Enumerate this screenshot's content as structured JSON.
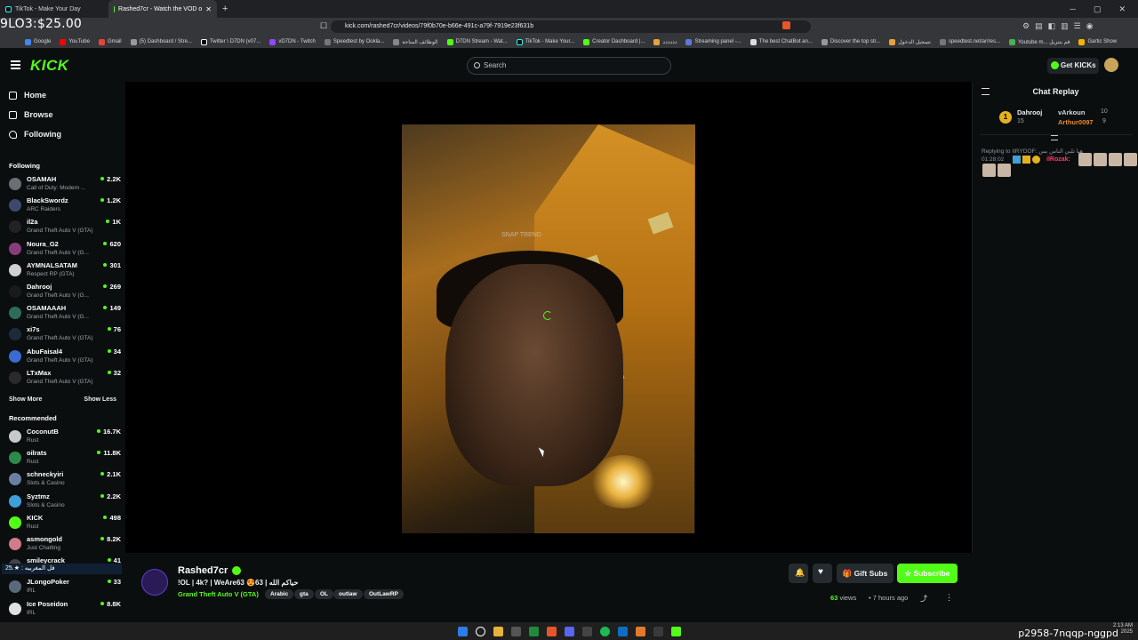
{
  "browser": {
    "tabs": [
      {
        "label": "TikTok - Make Your Day"
      },
      {
        "label": "Rashed7cr - Watch the VOD o"
      }
    ],
    "url": "kick.com/rashed7cr/videos/79f0b70e-b66e-491c-a79f-7919e23f631b",
    "bookmarks": [
      "Google",
      "YouTube",
      "Gmail",
      "(5) Dashboard / Stre...",
      "Twitter \\ D7DN (v07...",
      "vD7DN - Twitch",
      "Speedtest by Ookla...",
      "الوظائف المتاحة",
      "D7DN Stream - Wat...",
      "TikTok - Make Your...",
      "Creator Dashboard |...",
      "دددددد",
      "Streaming panel -...",
      "The best ChatBot an...",
      "Discover the top str...",
      "تسجيل الدخول",
      "speedtest.net/ar/res...",
      "Youtube m... قم بتنزيل",
      "Gartic Show"
    ]
  },
  "overlay": {
    "balance": "9LO3:$25.00",
    "obs_text": "فل المغربيه : ★.25",
    "code": "p2958-7nqqp-nggpd",
    "clock_time": "2:13 AM",
    "clock_date": "2025"
  },
  "header": {
    "logo": "KICK",
    "search_placeholder": "Search",
    "get_kicks": "Get KICKs"
  },
  "sidebar": {
    "nav": [
      {
        "label": "Home"
      },
      {
        "label": "Browse"
      },
      {
        "label": "Following"
      }
    ],
    "following_title": "Following",
    "following": [
      {
        "name": "OSAMAH",
        "category": "Call of Duty: Modern ...",
        "viewers": "2.2K",
        "color": "#6b6f73"
      },
      {
        "name": "BlackSwordz",
        "category": "ARC Raiders",
        "viewers": "1.2K",
        "color": "#3b4a6b"
      },
      {
        "name": "il2a",
        "category": "Grand Theft Auto V (GTA)",
        "viewers": "1K",
        "color": "#222"
      },
      {
        "name": "Noura_G2",
        "category": "Grand Theft Auto V (G...",
        "viewers": "620",
        "color": "#8a3c7a"
      },
      {
        "name": "AYMNALSATAM",
        "category": "Respect RP (GTA)",
        "viewers": "301",
        "color": "#d0d0d0"
      },
      {
        "name": "Dahrooj",
        "category": "Grand Theft Auto V (G...",
        "viewers": "269",
        "color": "#1a1a1a"
      },
      {
        "name": "OSAMAAAH",
        "category": "Grand Theft Auto V (G...",
        "viewers": "149",
        "color": "#2f6b5a"
      },
      {
        "name": "xi7s",
        "category": "Grand Theft Auto V (GTA)",
        "viewers": "76",
        "color": "#1e2a3a"
      },
      {
        "name": "AbuFaisal4",
        "category": "Grand Theft Auto V (GTA)",
        "viewers": "34",
        "color": "#3a6bd0"
      },
      {
        "name": "LTxMax",
        "category": "Grand Theft Auto V (GTA)",
        "viewers": "32",
        "color": "#2a2a2a"
      }
    ],
    "show_more": "Show More",
    "show_less": "Show Less",
    "recommended_title": "Recommended",
    "recommended": [
      {
        "name": "CoconutB",
        "category": "Rust",
        "viewers": "16.7K",
        "color": "#c9c9c9"
      },
      {
        "name": "oilrats",
        "category": "Rust",
        "viewers": "11.8K",
        "color": "#2e8a4a"
      },
      {
        "name": "schneckyiri",
        "category": "Slots & Casino",
        "viewers": "2.1K",
        "color": "#6a7fa0"
      },
      {
        "name": "Syztmz",
        "category": "Slots & Casino",
        "viewers": "2.2K",
        "color": "#3fa0d8"
      },
      {
        "name": "KICK",
        "category": "Rust",
        "viewers": "498",
        "color": "#53fc18"
      },
      {
        "name": "asmongold",
        "category": "Just Chatting",
        "viewers": "8.2K",
        "color": "#d07a8a"
      },
      {
        "name": "smileycrack",
        "category": "",
        "viewers": "41",
        "color": "#444"
      },
      {
        "name": "JLongoPoker",
        "category": "IRL",
        "viewers": "33",
        "color": "#5a6a7a"
      },
      {
        "name": "Ice Poseidon",
        "category": "IRL",
        "viewers": "8.8K",
        "color": "#e0e0e0"
      }
    ]
  },
  "video": {
    "watermark": "SNAP TREND"
  },
  "chat": {
    "title": "Chat Replay",
    "pinned": [
      {
        "user": "Dahrooj",
        "value": "15",
        "color": "#e4b21f"
      },
      {
        "user": "vArkoun",
        "value": "10",
        "color": "#c9c9c9"
      },
      {
        "user": "Arthur0097",
        "value": "9",
        "color": "#e58a2b"
      }
    ],
    "reply_text": "Replying to IIRYDOF: هيا تلبي الناس بس",
    "msg_time": "01:28:02",
    "msg_user": "ilRozak:"
  },
  "stream": {
    "channel": "Rashed7cr",
    "title": "!OL | 4k? | WeAre63 😍63 | حياكم الله",
    "category": "Grand Theft Auto V (GTA)",
    "tags": [
      "Arabic",
      "gta",
      "OL",
      "outlaw",
      "OutLawRP"
    ],
    "gift_subs": "Gift Subs",
    "subscribe": "Subscribe",
    "views_count": "63",
    "views_label": "views",
    "ago": "7 hours ago"
  }
}
